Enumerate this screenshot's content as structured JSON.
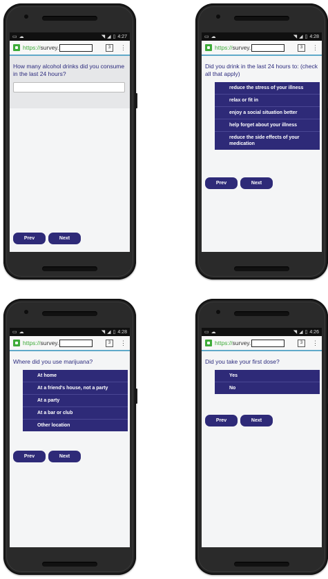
{
  "url": {
    "protocol": "https://",
    "host": "survey."
  },
  "phones": [
    {
      "time": "4:27",
      "tab_count": "3",
      "question": "How many alcohol drinks did you consume in the last 24 hours?",
      "type": "text",
      "prev": "Prev",
      "next": "Next"
    },
    {
      "time": "4:28",
      "tab_count": "3",
      "question": "Did you drink in the last 24 hours to: (check all that apply)",
      "options": [
        "reduce the stress of your illness",
        "relax or fit in",
        "enjoy a social situation better",
        "help forget about your illness",
        "reduce the side effects of your medication"
      ],
      "prev": "Prev",
      "next": "Next"
    },
    {
      "time": "4:28",
      "tab_count": "3",
      "question": "Where did you use marijuana?",
      "options": [
        "At home",
        "At a friend's house, not a party",
        "At a party",
        "At a bar or club",
        "Other location"
      ],
      "prev": "Prev",
      "next": "Next"
    },
    {
      "time": "4:26",
      "tab_count": "3",
      "question": "Did you take your first dose?",
      "options": [
        "Yes",
        "No"
      ],
      "prev": "Prev",
      "next": "Next"
    }
  ],
  "colors": {
    "accent": "#2e2a78",
    "question_text": "#2b2a7d",
    "lock_green": "#3eab39",
    "url_underline": "#5fa9c9"
  },
  "icons": {
    "status_left": [
      "image-icon",
      "cloud-icon"
    ],
    "status_right": [
      "wifi-icon",
      "signal-icon",
      "battery-icon"
    ],
    "url": "lock-icon",
    "menu": "overflow-menu-icon"
  }
}
